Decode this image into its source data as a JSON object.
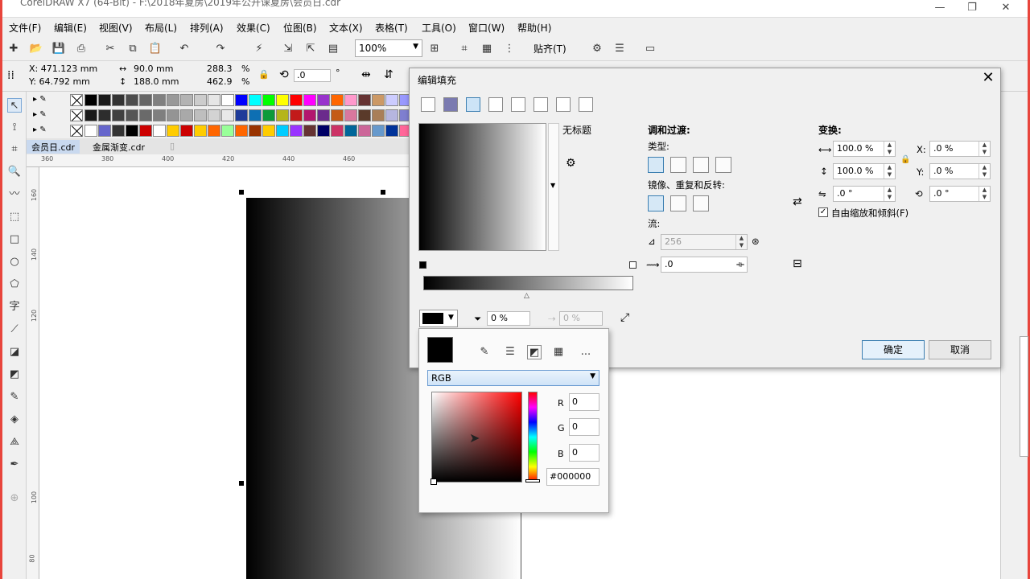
{
  "window": {
    "title": "CorelDRAW X7 (64-Bit) - F:\\2018年夏房\\2019年公开课夏房\\会员日.cdr"
  },
  "menu": [
    "文件(F)",
    "编辑(E)",
    "视图(V)",
    "布局(L)",
    "排列(A)",
    "效果(C)",
    "位图(B)",
    "文本(X)",
    "表格(T)",
    "工具(O)",
    "窗口(W)",
    "帮助(H)"
  ],
  "toolbar": {
    "zoom": "100%",
    "snap_label": "贴齐(T)"
  },
  "properties": {
    "x": "X: 471.123 mm",
    "y": "Y: 64.792 mm",
    "width": "90.0 mm",
    "height": "188.0 mm",
    "scale_x": "288.3",
    "scale_y": "462.9",
    "pct1": "%",
    "pct2": "%",
    "rotation": ".0",
    "degree": "°"
  },
  "doc_tabs": [
    "会员日.cdr",
    "金属渐变.cdr"
  ],
  "ruler": {
    "top": [
      "360",
      "380",
      "400",
      "420",
      "440",
      "460"
    ],
    "left": [
      "160",
      "140",
      "120",
      "100",
      "80"
    ]
  },
  "colors": {
    "accent": "#3c7fb1",
    "frame": "#e8453c"
  },
  "palette_rows": [
    [
      "#000000",
      "#1a1a1a",
      "#333333",
      "#4d4d4d",
      "#666666",
      "#808080",
      "#999999",
      "#b3b3b3",
      "#cccccc",
      "#e6e6e6",
      "#ffffff",
      "#0000ff",
      "#00ffff",
      "#00ff00",
      "#ffff00",
      "#ff0000",
      "#ff00ff",
      "#9933cc",
      "#ff6600",
      "#ff99cc",
      "#663333",
      "#cc9966",
      "#ccccff",
      "#9999ff",
      "#6699ff"
    ],
    [
      "#1a1a1a",
      "#2d2d2d",
      "#404040",
      "#555555",
      "#6a6a6a",
      "#7f7f7f",
      "#949494",
      "#a9a9a9",
      "#bebebe",
      "#d3d3d3",
      "#e8e8e8",
      "#1f3b99",
      "#0e6fb3",
      "#0c9a3a",
      "#b5b51c",
      "#c21a1a",
      "#b3166e",
      "#6b2a8c",
      "#c45a16",
      "#d9779e",
      "#5a3a2a",
      "#a97f58",
      "#b6b6e0",
      "#7f7fd0",
      "#4f73c7"
    ],
    [
      "#ffffff",
      "#6666cc",
      "#333333",
      "#000000",
      "#cc0000",
      "#ffffff",
      "#ffcc00",
      "#cc0000",
      "#ffcc00",
      "#ff6600",
      "#99ff99",
      "#ff6600",
      "#993300",
      "#ffcc00",
      "#00ccff",
      "#9933ff",
      "#663333",
      "#000066",
      "#cc3366",
      "#006699",
      "#cc6699",
      "#6699cc",
      "#003399",
      "#ff6699",
      "#3366cc"
    ]
  ],
  "dialog": {
    "title": "编辑填充",
    "untitled": "无标题",
    "blend_heading": "调和过渡:",
    "type_label": "类型:",
    "mirror_label": "镜像、重复和反转:",
    "flow_label": "流:",
    "steps": "256",
    "accel": ".0",
    "transparency": "0 %",
    "transparency2": "0 %",
    "transform_heading": "变换:",
    "width_pct": "100.0 %",
    "height_pct": "100.0 %",
    "x_label": "X:",
    "x_val": ".0 %",
    "y_label": "Y:",
    "y_val": ".0 %",
    "skew": ".0 °",
    "rotate": ".0 °",
    "free_scale": "自由缩放和倾斜(F)",
    "ok": "确定",
    "cancel": "取消",
    "more": "..."
  },
  "picker": {
    "mode": "RGB",
    "r_label": "R",
    "g_label": "G",
    "b_label": "B",
    "r": "0",
    "g": "0",
    "b": "0",
    "hex": "#000000"
  }
}
